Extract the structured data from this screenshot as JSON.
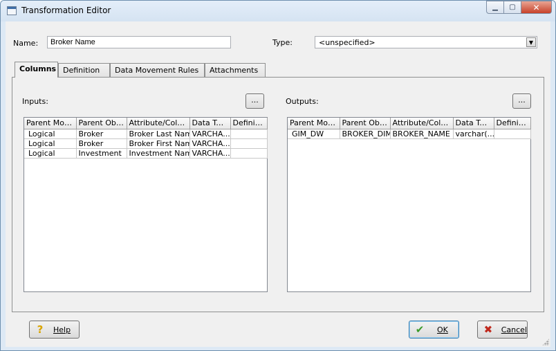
{
  "window": {
    "title": "Transformation Editor"
  },
  "form": {
    "name_label": "Name:",
    "name_value": "Broker Name",
    "type_label": "Type:",
    "type_value": "<unspecified>"
  },
  "tabs": [
    {
      "label": "Columns",
      "active": true
    },
    {
      "label": "Definition",
      "active": false
    },
    {
      "label": "Data Movement Rules",
      "active": false
    },
    {
      "label": "Attachments",
      "active": false
    }
  ],
  "inputs": {
    "label": "Inputs:",
    "browse_label": "...",
    "columns": [
      "Parent Model",
      "Parent Obj...",
      "Attribute/Column",
      "Data Type",
      "Definition"
    ],
    "rows": [
      [
        "Logical",
        "Broker",
        "Broker Last Name",
        "VARCHA...",
        ""
      ],
      [
        "Logical",
        "Broker",
        "Broker First Name",
        "VARCHA...",
        ""
      ],
      [
        "Logical",
        "Investment",
        "Investment Name",
        "VARCHA...",
        ""
      ]
    ]
  },
  "outputs": {
    "label": "Outputs:",
    "browse_label": "...",
    "columns": [
      "Parent Model",
      "Parent Obj...",
      "Attribute/Column",
      "Data Type",
      "Definition"
    ],
    "rows": [
      [
        "GIM_DW",
        "BROKER_DIM",
        "BROKER_NAME",
        "varchar(...",
        ""
      ]
    ]
  },
  "buttons": {
    "help": "Help",
    "ok": "OK",
    "cancel": "Cancel"
  },
  "icons": {
    "help": "question-mark-icon",
    "ok": "checkmark-icon",
    "cancel": "x-icon"
  },
  "colors": {
    "ok_check": "#3a9a2a",
    "cancel_x": "#c0281c",
    "help_q": "#d9a400"
  }
}
